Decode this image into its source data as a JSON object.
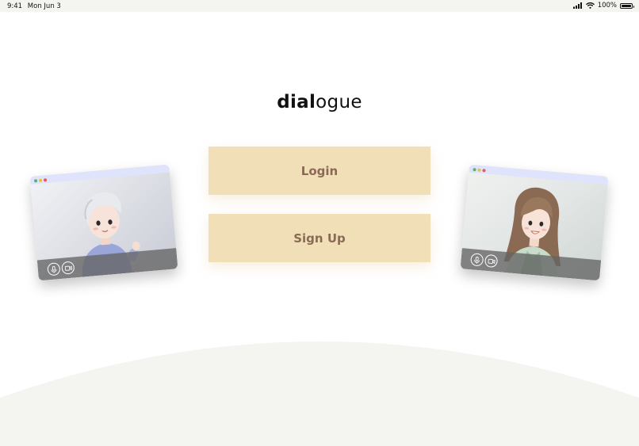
{
  "status_bar": {
    "time": "9:41",
    "date": "Mon Jun 3",
    "battery": "100%",
    "icons": [
      "signal-icon",
      "wifi-icon",
      "battery-icon"
    ]
  },
  "brand": {
    "bold": "dial",
    "regular": "ogue"
  },
  "buttons": {
    "login": "Login",
    "signup": "Sign Up"
  },
  "colors": {
    "button_bg": "#f1dfb7",
    "button_text": "#8a6a55",
    "status_bar_bg": "#f4f4f0",
    "bottom_curve": "#f4f4f0"
  },
  "call_windows": [
    {
      "name": "left-call-window",
      "person": "man with grey hair, waving",
      "controls": [
        "mic-icon",
        "camera-icon"
      ]
    },
    {
      "name": "right-call-window",
      "person": "woman with long brown hair, smiling",
      "controls": [
        "mic-icon",
        "camera-icon"
      ]
    }
  ]
}
